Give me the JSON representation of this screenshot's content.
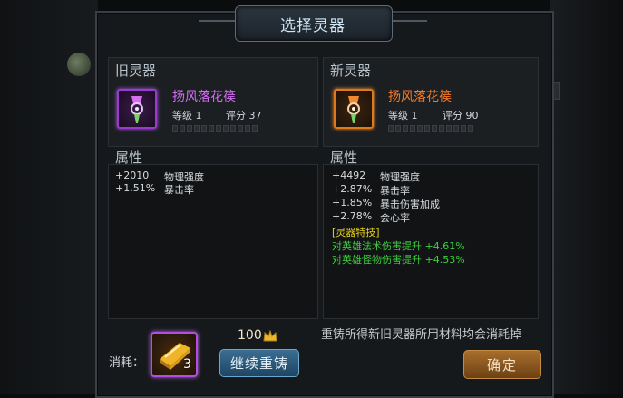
{
  "dialog": {
    "title": "选择灵器"
  },
  "old": {
    "header": "旧灵器",
    "item_name": "扬风落花篌",
    "level_label": "等级 1",
    "score_label": "评分 37",
    "attr_header": "属性",
    "attrs": [
      {
        "value": "+2010",
        "name": "物理强度"
      },
      {
        "value": "+1.51%",
        "name": "暴击率"
      }
    ]
  },
  "new": {
    "header": "新灵器",
    "item_name": "扬风落花篌",
    "level_label": "等级 1",
    "score_label": "评分 90",
    "attr_header": "属性",
    "attrs": [
      {
        "value": "+4492",
        "name": "物理强度"
      },
      {
        "value": "+2.87%",
        "name": "暴击率"
      },
      {
        "value": "+1.85%",
        "name": "暴击伤害加成"
      },
      {
        "value": "+2.78%",
        "name": "会心率"
      }
    ],
    "special_title": "[灵器特技]",
    "special_lines": [
      "对英雄法术伤害提升 +4.61%",
      "对英雄怪物伤害提升 +4.53%"
    ]
  },
  "footer": {
    "cost_label": "消耗：",
    "cost_count": "3",
    "gold_amount": "100",
    "reforge_label": "继续重铸",
    "notice": "重铸所得新旧灵器所用材料均会消耗掉",
    "confirm_label": "确定"
  },
  "colors": {
    "purple_rarity": "#d36cf5",
    "orange_rarity": "#f07a2a",
    "special_title": "#e6d020",
    "special_text": "#3fce3f"
  },
  "icons": {
    "old_item": "harp-charm-icon",
    "new_item": "harp-charm-icon",
    "cost_item": "gold-ingot-icon",
    "currency": "crown-icon"
  }
}
